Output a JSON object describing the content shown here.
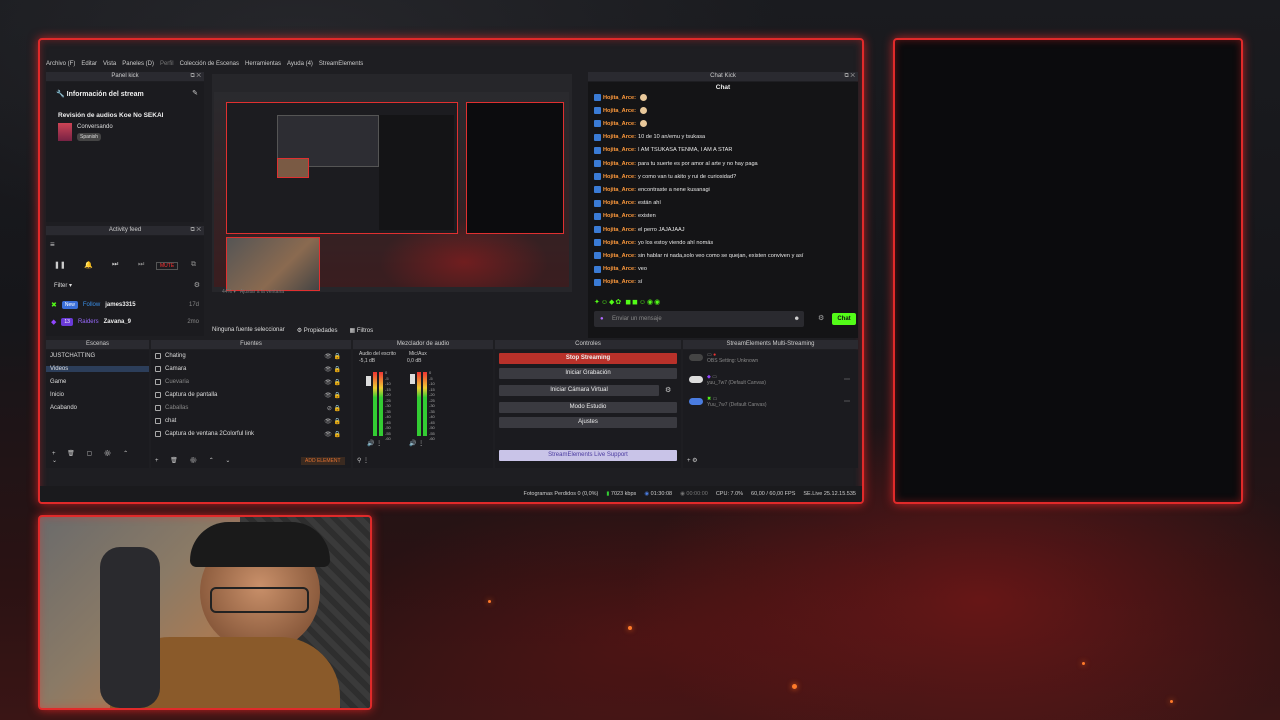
{
  "menu": [
    "Archivo (F)",
    "Editar",
    "Vista",
    "Paneles (D)",
    "Perfil",
    "Colección de Escenas",
    "Herramientas",
    "Ayuda (4)",
    "StreamElements"
  ],
  "panel_kick": {
    "title": "Panel kick",
    "section": "Información del stream",
    "stream_title": "Revisión de audios Koe No SEKAI",
    "category": "Conversando",
    "language": "Spanish"
  },
  "activity_feed": {
    "title": "Activity feed",
    "mute_label": "MUTE",
    "filter_label": "Filter",
    "rows": [
      {
        "badge1": "New",
        "badge2": "Follow",
        "name": "james3315",
        "time": "17d"
      },
      {
        "badge1": "13",
        "badge2": "Raiders",
        "name": "Zavana_9",
        "time": "2mo"
      }
    ]
  },
  "preview": {
    "zoom": "44%",
    "fit_label": "Ajustar a la ventana",
    "no_source": "Ninguna fuente seleccionar",
    "properties_label": "Propiedades",
    "filters_label": "Filtros"
  },
  "chat": {
    "panel_title": "Chat Kick",
    "header": "Chat",
    "messages": [
      {
        "user": "Hojita_Arce:",
        "text": ""
      },
      {
        "user": "Hojita_Arce:",
        "text": ""
      },
      {
        "user": "Hojita_Arce:",
        "text": ""
      },
      {
        "user": "Hojita_Arce:",
        "text": "10 de 10 an/emu y tsukasa"
      },
      {
        "user": "Hojita_Arce:",
        "text": "I AM TSUKASA TENMA, I AM A STAR"
      },
      {
        "user": "Hojita_Arce:",
        "text": "para tu suerte es por amor al arte y no hay paga"
      },
      {
        "user": "Hojita_Arce:",
        "text": "y como van tu akito y rui de curiosidad?"
      },
      {
        "user": "Hojita_Arce:",
        "text": "encontraste a nene kusanagi"
      },
      {
        "user": "Hojita_Arce:",
        "text": "están ahí"
      },
      {
        "user": "Hojita_Arce:",
        "text": "existen"
      },
      {
        "user": "Hojita_Arce:",
        "text": "el perro JAJAJAAJ"
      },
      {
        "user": "Hojita_Arce:",
        "text": "yo los estoy viendo ahí nomás"
      },
      {
        "user": "Hojita_Arce:",
        "text": "sin hablar ni nada,solo veo como se quejan, existen conviven y así"
      },
      {
        "user": "Hojita_Arce:",
        "text": "veo"
      },
      {
        "user": "Hojita_Arce:",
        "text": "sí"
      }
    ],
    "input_placeholder": "Enviar un mensaje",
    "send_label": "Chat"
  },
  "docks": {
    "scenes": {
      "title": "Escenas",
      "items": [
        "JUSTCHATTING",
        "Videos",
        "Game",
        "Inicio",
        "Acabando"
      ],
      "selected": 1
    },
    "sources": {
      "title": "Fuentes",
      "items": [
        "Chating",
        "Camara",
        "Cuevaria",
        "Captura de pantalla",
        "Caballas",
        "chat",
        "Captura de ventana 2Colorful link"
      ],
      "add_label": "ADD ELEMENT"
    },
    "mixer": {
      "title": "Mezclador de audio",
      "ch1": "Audio del escrito",
      "ch1_db": "-5,1 dB",
      "ch2": "Mic/Aux",
      "ch2_db": "0,0 dB",
      "scale": [
        "0",
        "-5",
        "-10",
        "-15",
        "-20",
        "-25",
        "-30",
        "-35",
        "-40",
        "-45",
        "-50",
        "-55",
        "-60"
      ]
    },
    "controls": {
      "title": "Controles",
      "stop": "Stop Streaming",
      "record": "Iniciar Grabación",
      "vcam": "Iniciar Cámara Virtual",
      "studio": "Modo Estudio",
      "settings": "Ajustes",
      "support": "StreamElements Live Support"
    },
    "multi": {
      "title": "StreamElements Multi-Streaming",
      "rows": [
        "OBS Setting: Unknown",
        "yuu_7w7 (Default Canvas)",
        "Yuu_7w7 (Default Canvas)"
      ]
    }
  },
  "status": {
    "dropped": "Fotogramas Perdidos 0 (0,0%)",
    "bitrate": "7023 kbps",
    "time1": "01:30:08",
    "time2": "00:00:00",
    "cpu": "CPU: 7.0%",
    "fps": "60,00 / 60,00 FPS",
    "version": "SE.Live 25.12.15.535"
  },
  "colors": {
    "frame_red": "#e02a2a",
    "kick_green": "#53fc18",
    "chat_user": "#ff9a3c"
  }
}
